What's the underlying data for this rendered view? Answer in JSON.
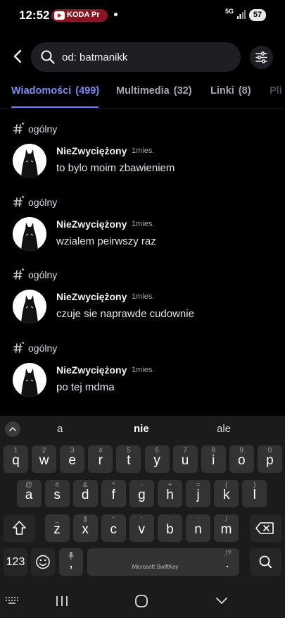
{
  "status_bar": {
    "time": "12:52",
    "notification_label": "KODA Pr",
    "network": "5G",
    "battery": "57"
  },
  "search": {
    "query": "od: batmanikk"
  },
  "tabs": [
    {
      "label": "Wiadomości",
      "count": "(499)",
      "active": true
    },
    {
      "label": "Multimedia",
      "count": "(32)",
      "active": false
    },
    {
      "label": "Linki",
      "count": "(8)",
      "active": false
    },
    {
      "label": "Pli",
      "count": "",
      "active": false
    }
  ],
  "results": [
    {
      "channel": "ogólny",
      "author": "NieZwyciężony",
      "time": "1mies.",
      "text": "to bylo moim zbawieniem"
    },
    {
      "channel": "ogólny",
      "author": "NieZwyciężony",
      "time": "1mies.",
      "text": "wzialem peirwszy raz"
    },
    {
      "channel": "ogólny",
      "author": "NieZwyciężony",
      "time": "1mies.",
      "text": "czuje sie naprawde cudownie"
    },
    {
      "channel": "ogólny",
      "author": "NieZwyciężony",
      "time": "1mies.",
      "text": "po tej mdma"
    }
  ],
  "keyboard": {
    "suggestions": [
      "a",
      "nie",
      "ale"
    ],
    "row1": [
      {
        "k": "q",
        "h": "1"
      },
      {
        "k": "w",
        "h": "2"
      },
      {
        "k": "e",
        "h": "3"
      },
      {
        "k": "r",
        "h": "4"
      },
      {
        "k": "t",
        "h": "5"
      },
      {
        "k": "y",
        "h": "6"
      },
      {
        "k": "u",
        "h": "7"
      },
      {
        "k": "i",
        "h": "8"
      },
      {
        "k": "o",
        "h": "9"
      },
      {
        "k": "p",
        "h": "0"
      }
    ],
    "row2": [
      {
        "k": "a",
        "h": "@"
      },
      {
        "k": "s",
        "h": "#"
      },
      {
        "k": "d",
        "h": "&"
      },
      {
        "k": "f",
        "h": "*"
      },
      {
        "k": "g",
        "h": "-"
      },
      {
        "k": "h",
        "h": "+"
      },
      {
        "k": "j",
        "h": "="
      },
      {
        "k": "k",
        "h": "("
      },
      {
        "k": "l",
        "h": ")"
      }
    ],
    "row3": [
      {
        "k": "z",
        "h": "_"
      },
      {
        "k": "x",
        "h": "$"
      },
      {
        "k": "c",
        "h": "\""
      },
      {
        "k": "v",
        "h": "'"
      },
      {
        "k": "b",
        "h": ":"
      },
      {
        "k": "n",
        "h": ";"
      },
      {
        "k": "m",
        "h": "/"
      }
    ],
    "numbers_label": "123",
    "comma": ",",
    "period": ".",
    "period_hint": ",!?",
    "space_label": "Microsoft SwiftKey"
  },
  "icons": {
    "back": "back-arrow-icon",
    "search": "search-icon",
    "filter": "filter-sliders-icon",
    "channel": "thread-hashtag-icon"
  },
  "colors": {
    "accent": "#7e8bf0",
    "background": "#000000",
    "search_bg": "#1e1f24",
    "keyboard_bg": "#1b1b1b"
  }
}
